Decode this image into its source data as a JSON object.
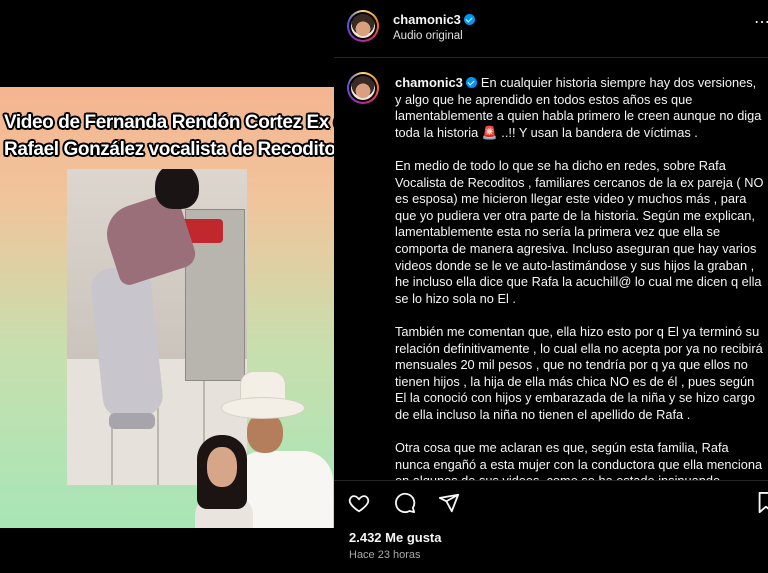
{
  "media": {
    "headline_line1": "Video de Fernanda Rendón Cortez Ex de",
    "headline_line2": "Rafael González vocalista de Recoditos"
  },
  "post_header": {
    "username": "chamonic3",
    "subtitle": "Audio original",
    "more_icon": "more-horizontal-icon"
  },
  "caption": {
    "username": "chamonic3",
    "paragraphs": [
      "En cualquier historia siempre hay dos versiones, y algo que he aprendido en todos estos años es que lamentablemente a quien habla primero le creen aunque no diga toda la historia 🚨 ..!! Y usan la bandera de víctimas .",
      "En medio de todo lo que se ha dicho en redes, sobre Rafa Vocalista de Recoditos , familiares cercanos de la ex pareja ( NO es esposa) me hicieron llegar este video y muchos más , para que yo pudiera ver otra parte de la historia. Según me explican, lamentablemente esta no sería la primera vez que ella se comporta de manera agresiva. Incluso aseguran que hay varios videos donde se le ve auto-lastimándose y sus hijos la graban , he incluso ella dice que Rafa la acuchill@ lo cual me dicen q ella se lo hizo sola no El .",
      "También me comentan que, ella hizo esto por q El ya terminó su relación definitivamente , lo cual ella no acepta por ya no recibirá mensuales 20 mil pesos , que no tendría por q ya que ellos no tienen hijos , la hija de ella más chica NO es de él , pues según El la conoció con hijos y embarazada de la niña y se hizo cargo de ella incluso la niña no tienen el apellido de Rafa .",
      "Otra cosa que me aclaran es que, según esta familia, Rafa nunca engañó a esta mujer con la conductora que ella menciona en algunos de sus videos, como se ha estado insinuando. Celeste su"
    ]
  },
  "actions": {
    "like_icon": "heart-icon",
    "comment_icon": "comment-icon",
    "share_icon": "share-icon",
    "save_icon": "bookmark-icon"
  },
  "stats": {
    "likes": "2.432 Me gusta",
    "time_ago": "Hace 23 horas"
  }
}
